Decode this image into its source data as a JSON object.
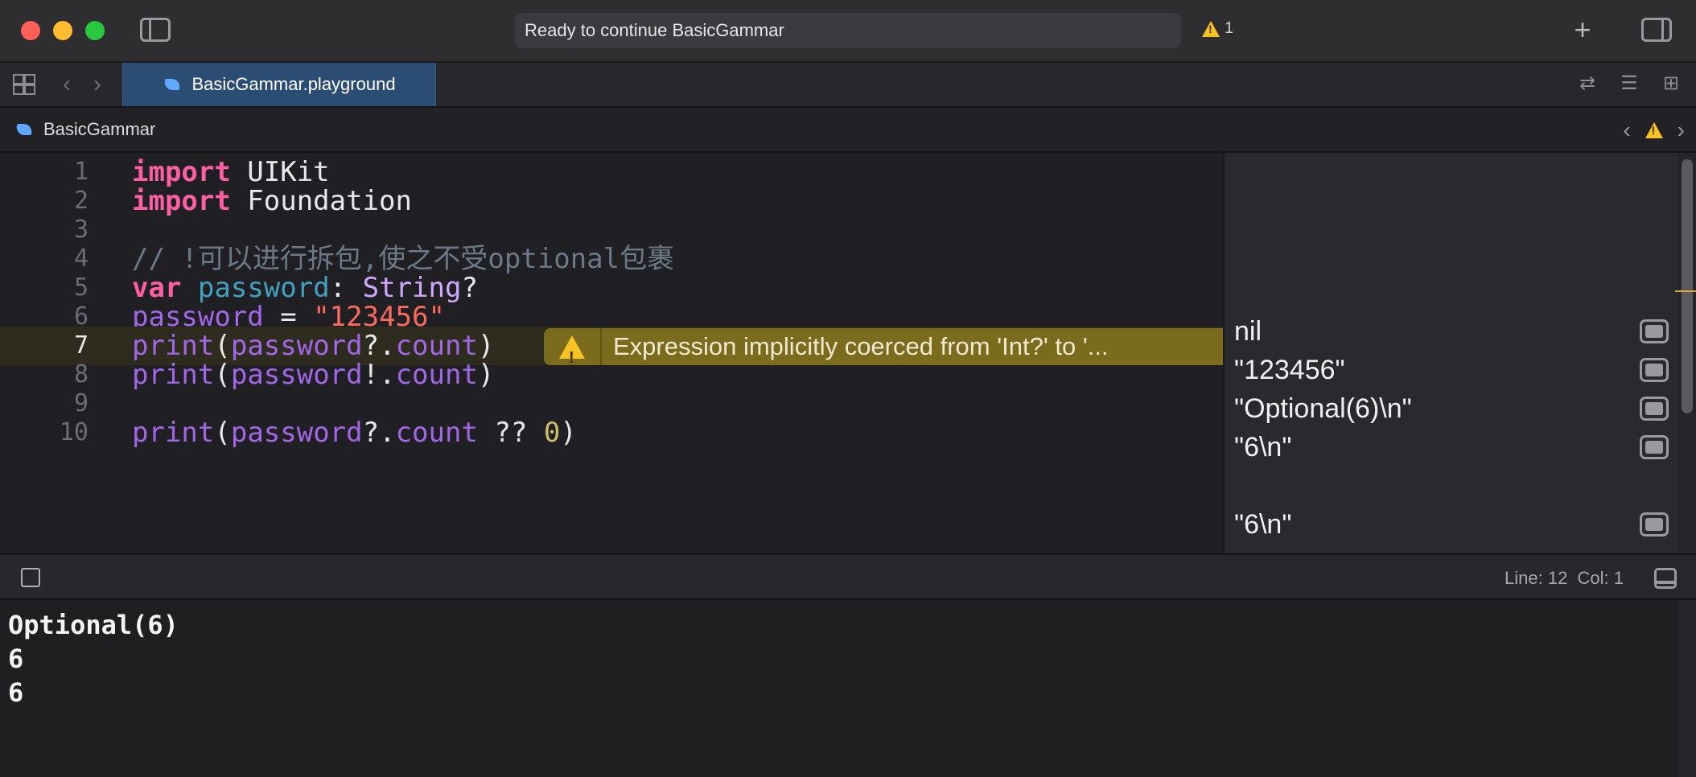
{
  "titlebar": {
    "activity_text": "Ready to continue BasicGammar",
    "warning_count": "1",
    "add_label": "+"
  },
  "tabbar": {
    "active_tab": "BasicGammar.playground"
  },
  "jumpbar": {
    "item": "BasicGammar"
  },
  "editor": {
    "lines": [
      {
        "number": "1"
      },
      {
        "number": "2"
      },
      {
        "number": "3"
      },
      {
        "number": "4"
      },
      {
        "number": "5"
      },
      {
        "number": "6"
      },
      {
        "number": "7"
      },
      {
        "number": "8"
      },
      {
        "number": "9"
      },
      {
        "number": "10"
      }
    ],
    "code": {
      "l1_kw": "import",
      "l1_rest": " UIKit",
      "l2_kw": "import",
      "l2_rest": " Foundation",
      "l4_comment": "// !可以进行拆包,使之不受optional包裹",
      "l5_kw": "var",
      "l5_name": "password",
      "l5_colon": ": ",
      "l5_type": "String",
      "l5_q": "?",
      "l6_name": "password",
      "l6_eq": " = ",
      "l6_str": "\"123456\"",
      "l7_fn": "print",
      "l7_open": "(",
      "l7_var": "password",
      "l7_op": "?.",
      "l7_prop": "count",
      "l7_close": ")",
      "l8_fn": "print",
      "l8_open": "(",
      "l8_var": "password",
      "l8_op": "!.",
      "l8_prop": "count",
      "l8_close": ")",
      "l10_fn": "print",
      "l10_open": "(",
      "l10_var": "password",
      "l10_op": "?.",
      "l10_prop": "count",
      "l10_coal": " ?? ",
      "l10_num": "0",
      "l10_close": ")"
    },
    "inline_warning": "Expression implicitly coerced from 'Int?' to '..."
  },
  "results": {
    "line5": "nil",
    "line6": "\"123456\"",
    "line7": "\"Optional(6)\\n\"",
    "line8": "\"6\\n\"",
    "line10": "\"6\\n\""
  },
  "debugbar": {
    "position": "Line: 12  Col: 1"
  },
  "console": {
    "lines": [
      "Optional(6)",
      "6",
      "6"
    ]
  },
  "colors": {
    "keyword": "#fc5fa3",
    "string": "#fc6a5d",
    "number": "#d0bf69",
    "comment": "#6c7986",
    "warning": "#f7c324"
  }
}
